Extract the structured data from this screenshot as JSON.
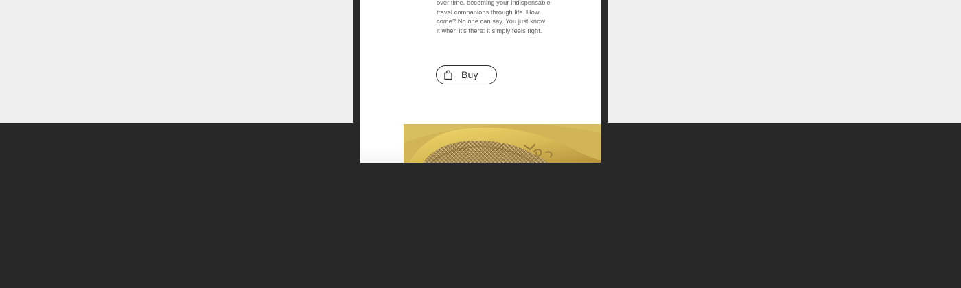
{
  "product": {
    "description_lines": [
      "over time, becoming your indispensable",
      "travel companions through life. How",
      "come? No one can say. You just know",
      "it when it's there: it simply feels right."
    ],
    "buy_button": {
      "label": "Buy",
      "icon": "shopping-bag-icon"
    },
    "image": {
      "subject": "yellow shoe detail",
      "colors": {
        "primary": "#d8bb58",
        "shadow": "#9f7b2d",
        "highlight": "#f0d86a"
      }
    }
  },
  "colors": {
    "page_top_background": "#efefef",
    "page_bottom_background": "#282828",
    "phone_frame": "#2a2a2a",
    "screen_background": "#ffffff",
    "text": "#5f5f5f",
    "button_border": "#303030"
  }
}
